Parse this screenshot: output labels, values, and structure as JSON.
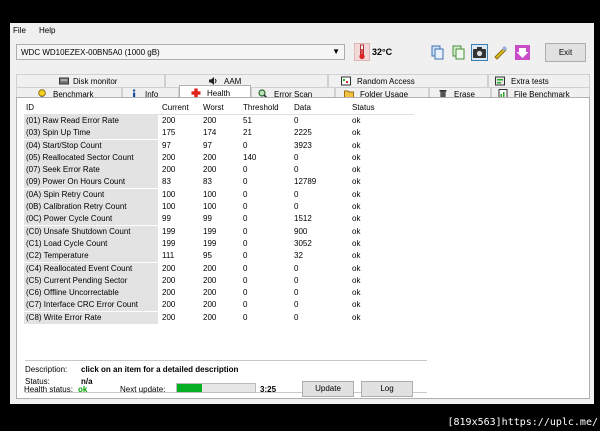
{
  "menu": {
    "file": "File",
    "help": "Help"
  },
  "drive": {
    "selected": "WDC WD10EZEX-00BN5A0 (1000 gB)"
  },
  "temperature": "32°C",
  "exit_label": "Exit",
  "tabs_top": [
    {
      "label": "Disk monitor",
      "icon": "disk-icon"
    },
    {
      "label": "AAM",
      "icon": "speaker-icon"
    },
    {
      "label": "Random Access",
      "icon": "random-access-icon"
    },
    {
      "label": "Extra tests",
      "icon": "tests-icon"
    }
  ],
  "tabs_bottom": [
    {
      "label": "Benchmark",
      "icon": "lightbulb-icon"
    },
    {
      "label": "Info",
      "icon": "info-icon"
    },
    {
      "label": "Health",
      "icon": "red-cross-icon"
    },
    {
      "label": "Error Scan",
      "icon": "magnifier-icon"
    },
    {
      "label": "Folder Usage",
      "icon": "folder-icon"
    },
    {
      "label": "Erase",
      "icon": "trash-icon"
    },
    {
      "label": "File Benchmark",
      "icon": "file-benchmark-icon"
    }
  ],
  "table": {
    "headers": [
      "ID",
      "Current",
      "Worst",
      "Threshold",
      "Data",
      "Status"
    ],
    "rows": [
      [
        "(01) Raw Read Error Rate",
        "200",
        "200",
        "51",
        "0",
        "ok"
      ],
      [
        "(03) Spin Up Time",
        "175",
        "174",
        "21",
        "2225",
        "ok"
      ],
      [
        "(04) Start/Stop Count",
        "97",
        "97",
        "0",
        "3923",
        "ok"
      ],
      [
        "(05) Reallocated Sector Count",
        "200",
        "200",
        "140",
        "0",
        "ok"
      ],
      [
        "(07) Seek Error Rate",
        "200",
        "200",
        "0",
        "0",
        "ok"
      ],
      [
        "(09) Power On Hours Count",
        "83",
        "83",
        "0",
        "12789",
        "ok"
      ],
      [
        "(0A) Spin Retry Count",
        "100",
        "100",
        "0",
        "0",
        "ok"
      ],
      [
        "(0B) Calibration Retry Count",
        "100",
        "100",
        "0",
        "0",
        "ok"
      ],
      [
        "(0C) Power Cycle Count",
        "99",
        "99",
        "0",
        "1512",
        "ok"
      ],
      [
        "(C0) Unsafe Shutdown Count",
        "199",
        "199",
        "0",
        "900",
        "ok"
      ],
      [
        "(C1) Load Cycle Count",
        "199",
        "199",
        "0",
        "3052",
        "ok"
      ],
      [
        "(C2) Temperature",
        "111",
        "95",
        "0",
        "32",
        "ok"
      ],
      [
        "(C4) Reallocated Event Count",
        "200",
        "200",
        "0",
        "0",
        "ok"
      ],
      [
        "(C5) Current Pending Sector",
        "200",
        "200",
        "0",
        "0",
        "ok"
      ],
      [
        "(C6) Offline Uncorrectable",
        "200",
        "200",
        "0",
        "0",
        "ok"
      ],
      [
        "(C7) Interface CRC Error Count",
        "200",
        "200",
        "0",
        "0",
        "ok"
      ],
      [
        "(C8) Write Error Rate",
        "200",
        "200",
        "0",
        "0",
        "ok"
      ]
    ]
  },
  "description": {
    "label": "Description:",
    "value": "click on an item for a detailed description"
  },
  "status": {
    "label": "Status:",
    "value": "n/a"
  },
  "health": {
    "label": "Health status:",
    "value": "ok",
    "color": "#00a000"
  },
  "next_update": {
    "label": "Next update:",
    "time": "3:25",
    "progress": 0.32
  },
  "buttons": {
    "update": "Update",
    "log": "Log"
  },
  "watermark": "[819x563]https://uplc.me/"
}
